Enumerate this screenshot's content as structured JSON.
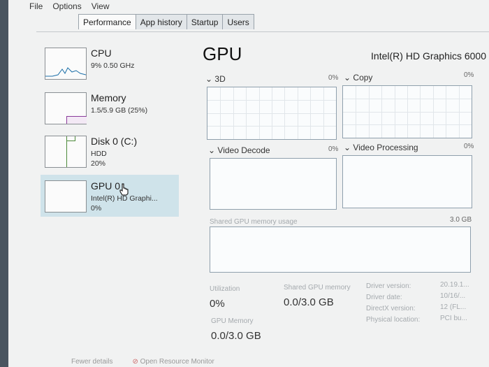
{
  "menu": [
    "File",
    "Options",
    "View"
  ],
  "tabs": [
    "Performance",
    "App history",
    "Startup",
    "Users"
  ],
  "sidebar": {
    "items": [
      {
        "title": "CPU",
        "sub": "9%  0.50 GHz",
        "sub2": ""
      },
      {
        "title": "Memory",
        "sub": "1.5/5.9 GB (25%)",
        "sub2": ""
      },
      {
        "title": "Disk 0 (C:)",
        "sub": "HDD",
        "sub2": "20%"
      },
      {
        "title": "GPU 0",
        "sub": "Intel(R) HD Graphi...",
        "sub2": "0%"
      }
    ]
  },
  "main": {
    "title": "GPU",
    "gpu_name": "Intel(R) HD Graphics 6000",
    "graphs": [
      {
        "label": "3D",
        "pct": "0%"
      },
      {
        "label": "Copy",
        "pct": "0%"
      },
      {
        "label": "Video Decode",
        "pct": "0%"
      },
      {
        "label": "Video Processing",
        "pct": "0%"
      }
    ],
    "shared_memory": {
      "label": "Shared GPU memory usage",
      "max": "3.0 GB"
    },
    "stats": {
      "utilization_label": "Utilization",
      "utilization_value": "0%",
      "shared_label": "Shared GPU memory",
      "shared_value": "0.0/3.0 GB",
      "gpu_memory_label": "GPU Memory",
      "gpu_memory_value": "0.0/3.0 GB"
    },
    "info": [
      {
        "label": "Driver version:",
        "value": "20.19.1..."
      },
      {
        "label": "Driver date:",
        "value": "10/16/..."
      },
      {
        "label": "DirectX version:",
        "value": "12 (FL..."
      },
      {
        "label": "Physical location:",
        "value": "PCI bu..."
      }
    ]
  },
  "footer": {
    "fewer_details": "Fewer details",
    "open_monitor": "Open Resource Monitor"
  }
}
